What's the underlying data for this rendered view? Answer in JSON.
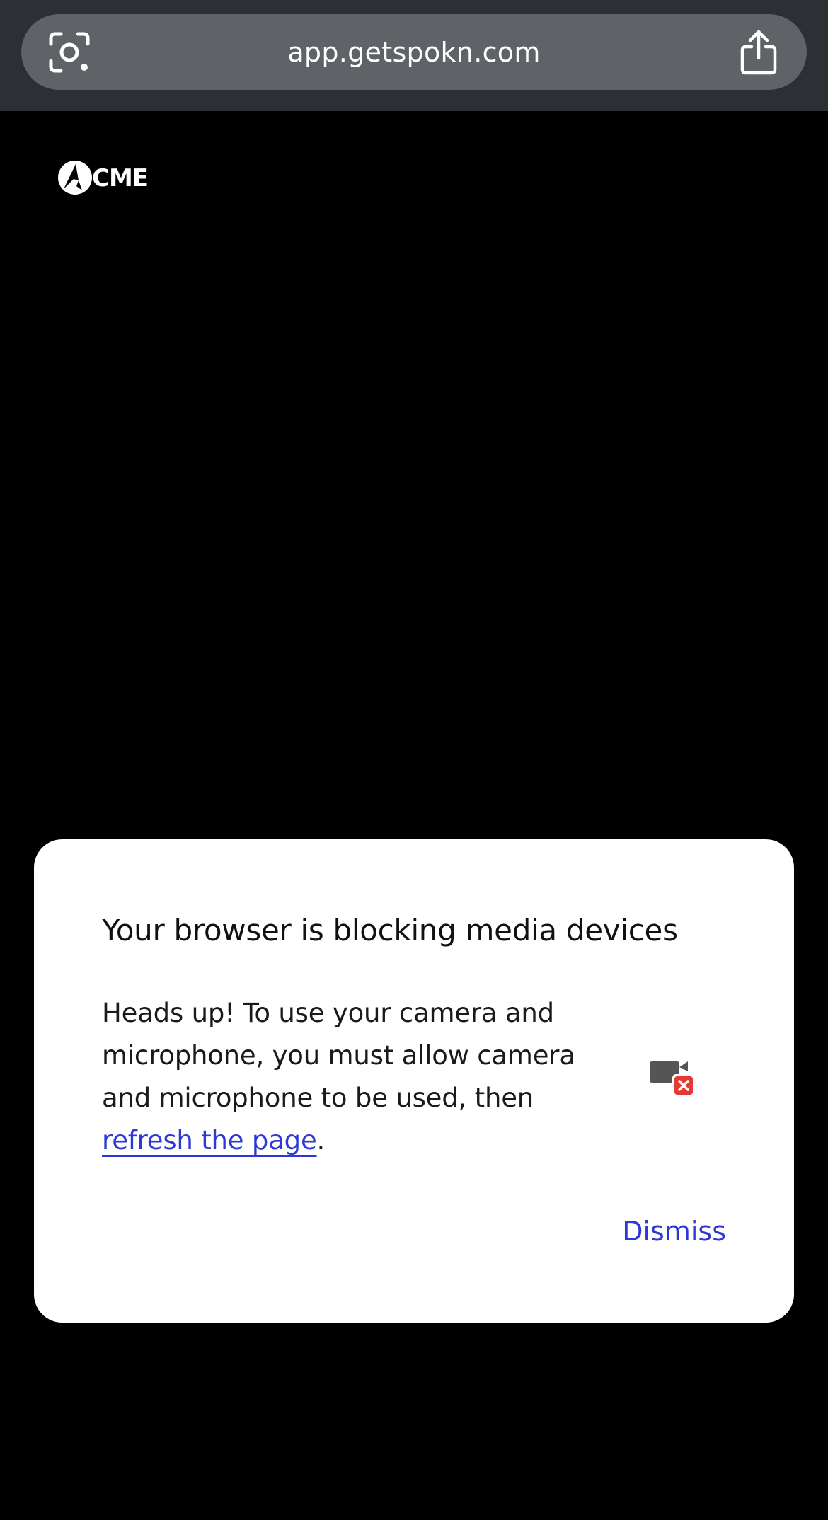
{
  "browser": {
    "url": "app.getspokn.com",
    "lens_icon": "camera-search-icon",
    "share_icon": "share-icon"
  },
  "logo": {
    "text": "CME",
    "icon": "acme-logo-mark"
  },
  "dialog": {
    "title": "Your browser is blocking media devices",
    "body_text": "Heads up! To use your camera and microphone, you must allow camera and microphone to be used, then",
    "link_text": "refresh the page",
    "trailing_text": ".",
    "icon": "camera-blocked-icon",
    "dismiss_label": "Dismiss"
  },
  "colors": {
    "page_background": "#000000",
    "browser_bar": "#2c2f33",
    "url_pill": "#5f6368",
    "dialog_background": "#ffffff",
    "link_blue": "#2d38d6",
    "error_red": "#e53935"
  }
}
